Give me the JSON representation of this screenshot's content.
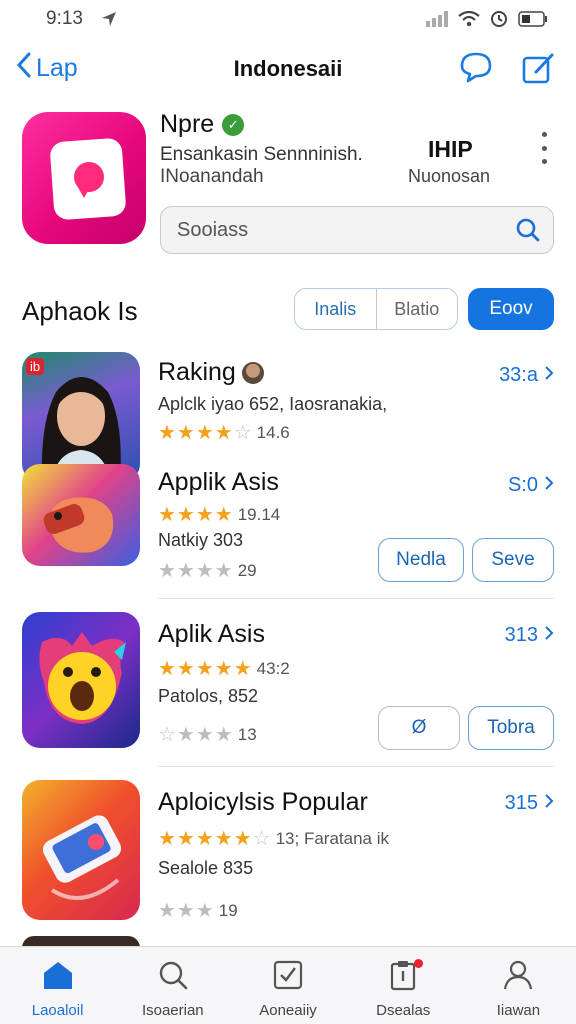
{
  "status_bar": {
    "time": "9:13"
  },
  "nav": {
    "back_label": "Lap",
    "title": "Indonesaii"
  },
  "profile": {
    "name": "Npre",
    "subtitle": "Ensankasin Sennninish.",
    "subtitle2": "INoanandah",
    "code": "IHIP",
    "code_sub": "Nuonosan"
  },
  "search": {
    "placeholder": "Sooiass"
  },
  "section": {
    "title": "Aphaok Is",
    "seg_left": "Inalis",
    "seg_right": "Blatio",
    "primary": "Eoov"
  },
  "apps": [
    {
      "name": "Raking",
      "price": "33:a",
      "desc": "Aplclk iyao 652, Iaosranakia,",
      "rating_filled": 4,
      "rating_text": "14.6",
      "badge": "ib"
    },
    {
      "name": "Applik Asis",
      "price": "S:0",
      "rating_filled": 4,
      "rating_text": "19.14",
      "desc": "Natkiy 303",
      "rating2_text": "29",
      "btn1": "Nedla",
      "btn2": "Seve"
    },
    {
      "name": "Aplik Asis",
      "price": "313",
      "rating_filled": 5,
      "rating_text": "43:2",
      "desc": "Patolos, 852",
      "rating2_text": "13",
      "btn1": "Ø",
      "btn2": "Tobra"
    },
    {
      "name": "Aploicylsis Popular",
      "price": "315",
      "rating_filled": 5,
      "rating_text": "13; Faratana ik",
      "desc": "Sealole 835",
      "rating2_text": "19"
    }
  ],
  "tabs": [
    {
      "label": "Laoaloil",
      "icon": "home-icon",
      "active": true
    },
    {
      "label": "Isoaerian",
      "icon": "search-icon"
    },
    {
      "label": "Aoneaiiy",
      "icon": "task-icon"
    },
    {
      "label": "Dsealas",
      "icon": "clipboard-icon",
      "dot": true
    },
    {
      "label": "Iiawan",
      "icon": "person-icon"
    }
  ],
  "colors": {
    "accent": "#1674e0",
    "star": "#f4a21c",
    "pink": "#e6087c"
  }
}
